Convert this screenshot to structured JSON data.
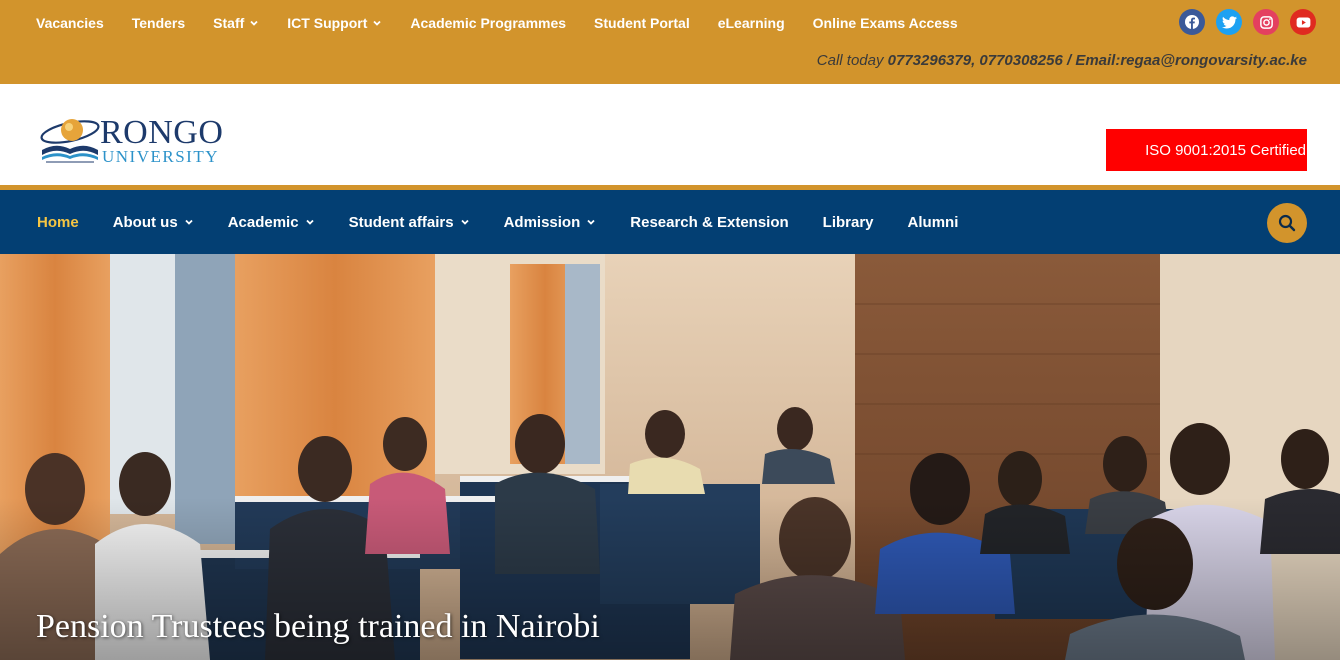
{
  "topbar": {
    "links": [
      {
        "label": "Vacancies",
        "dropdown": false
      },
      {
        "label": "Tenders",
        "dropdown": false
      },
      {
        "label": "Staff",
        "dropdown": true
      },
      {
        "label": "ICT Support",
        "dropdown": true
      },
      {
        "label": "Academic Programmes",
        "dropdown": false
      },
      {
        "label": "Student Portal",
        "dropdown": false
      },
      {
        "label": "eLearning",
        "dropdown": false
      },
      {
        "label": "Online Exams Access",
        "dropdown": false
      }
    ],
    "social": [
      "facebook-icon",
      "twitter-icon",
      "instagram-icon",
      "youtube-icon"
    ],
    "contact_prefix": "Call today ",
    "contact_details": "0773296379, 0770308256 / Email:regaa@rongovarsity.ac.ke"
  },
  "logo": {
    "line1": "RONGO",
    "line2": "UNIVERSITY"
  },
  "iso_badge": "ISO 9001:2015 Certified",
  "mainnav": {
    "items": [
      {
        "label": "Home",
        "dropdown": false,
        "active": true
      },
      {
        "label": "About us",
        "dropdown": true,
        "active": false
      },
      {
        "label": "Academic",
        "dropdown": true,
        "active": false
      },
      {
        "label": "Student affairs",
        "dropdown": true,
        "active": false
      },
      {
        "label": "Admission",
        "dropdown": true,
        "active": false
      },
      {
        "label": "Research & Extension",
        "dropdown": false,
        "active": false
      },
      {
        "label": "Library",
        "dropdown": false,
        "active": false
      },
      {
        "label": "Alumni",
        "dropdown": false,
        "active": false
      }
    ],
    "search_icon": "search-icon"
  },
  "hero": {
    "title": "Pension Trustees being trained in Nairobi"
  },
  "colors": {
    "topbar": "#d2942c",
    "nav": "#033f73",
    "active": "#f5c543",
    "iso": "#ff0000"
  }
}
